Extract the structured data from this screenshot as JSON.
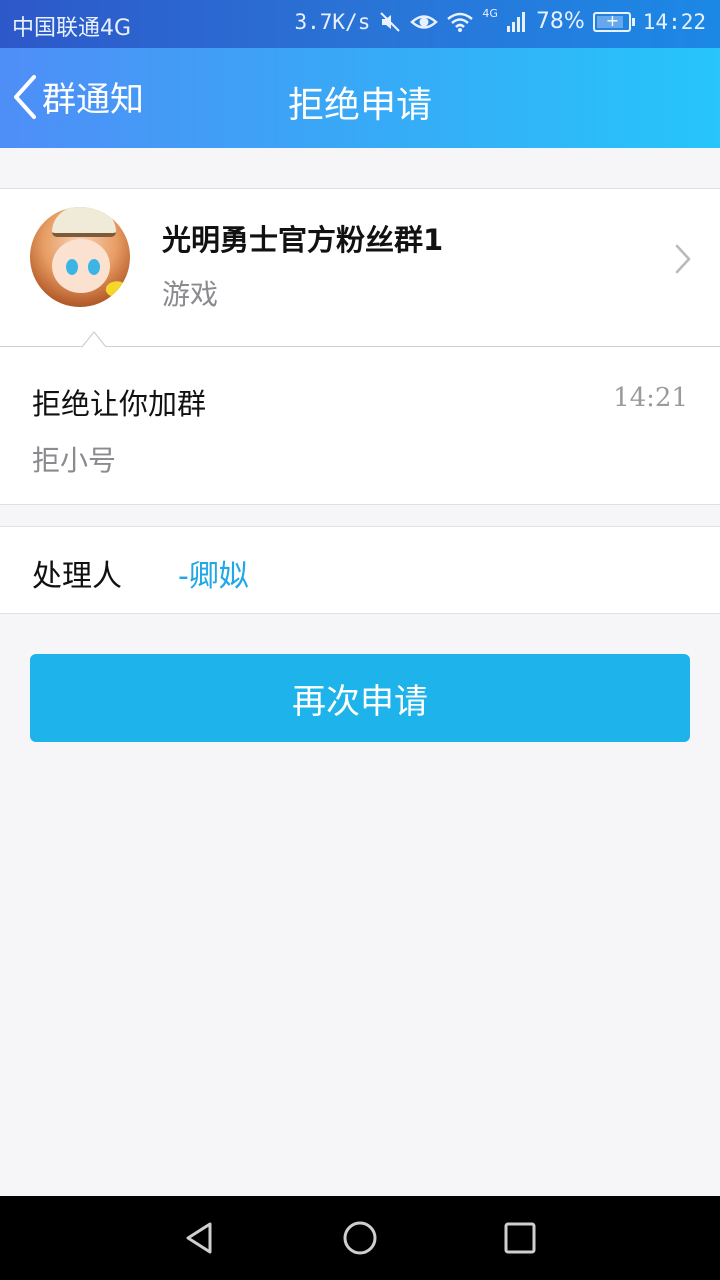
{
  "status_bar": {
    "carrier": "中国联通4G",
    "speed": "3.7K/s",
    "network": "4G",
    "battery": "78%",
    "time": "14:22",
    "icons": [
      "mute-icon",
      "eye-icon",
      "wifi-icon",
      "signal-icon",
      "battery-icon"
    ]
  },
  "nav": {
    "back_label": "群通知",
    "title": "拒绝申请"
  },
  "group": {
    "name": "光明勇士官方粉丝群1",
    "type": "游戏"
  },
  "message": {
    "title": "拒绝让你加群",
    "time": "14:21",
    "reason": "拒小号"
  },
  "handler": {
    "label": "处理人",
    "name": "-卿姒"
  },
  "actions": {
    "reapply_label": "再次申请"
  },
  "colors": {
    "accent": "#1fb3ec",
    "handler_link": "#1fa7e6",
    "nav_gradient_start": "#4f8ef7",
    "nav_gradient_end": "#26c5fb"
  }
}
